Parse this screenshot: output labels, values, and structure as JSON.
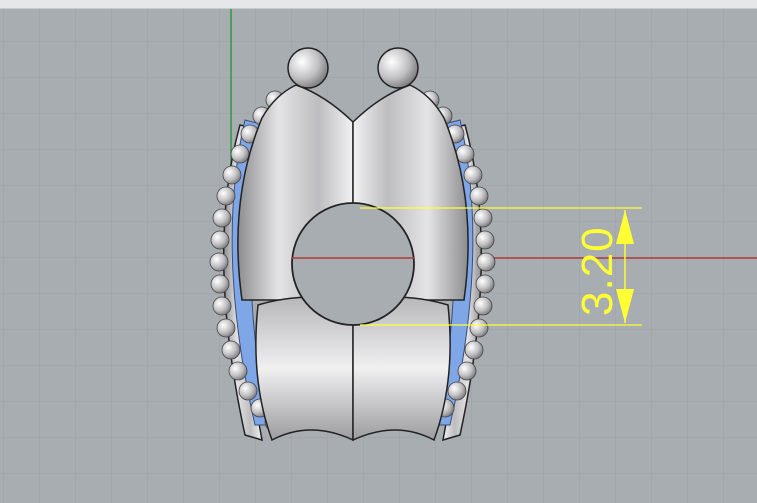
{
  "viewport": {
    "background": "#a8adb2",
    "grid_color": "#9ca1a6",
    "x_axis_color": "#b03a3a",
    "y_axis_color": "#2f9a3a"
  },
  "model": {
    "metal_color": "#c8c8cc",
    "gem_color": "#7fa6e6"
  },
  "dimension": {
    "value": "3.20",
    "color": "#ffff33"
  }
}
